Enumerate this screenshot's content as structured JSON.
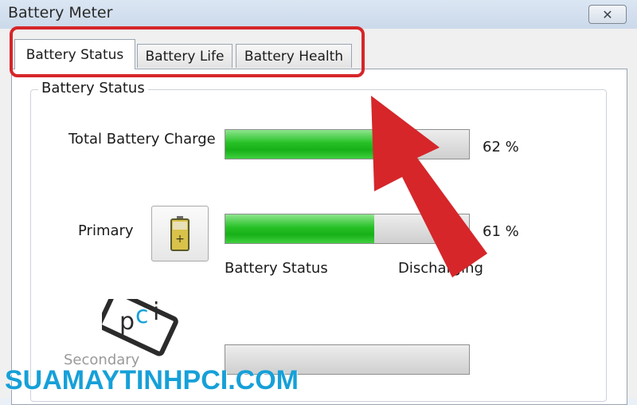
{
  "window": {
    "title": "Battery Meter",
    "close_symbol": "✕"
  },
  "tabs": [
    {
      "label": "Battery Status",
      "active": true
    },
    {
      "label": "Battery Life",
      "active": false
    },
    {
      "label": "Battery Health",
      "active": false
    }
  ],
  "group": {
    "label": "Battery Status",
    "total": {
      "label": "Total Battery Charge",
      "percent_value": 62,
      "percent_text": "62 %"
    },
    "primary": {
      "label": "Primary",
      "percent_value": 61,
      "percent_text": "61 %",
      "status_label": "Battery Status",
      "status_value": "Discharging",
      "icon": "battery-icon"
    },
    "secondary": {
      "label": "Secondary",
      "percent_value": 0
    }
  },
  "annotation": {
    "highlight_color": "#d6262a",
    "arrow_color": "#d6262a"
  },
  "watermark": {
    "text": "SUAMAYTINHPCI.COM",
    "logo": "pci",
    "color": "#16a0d8"
  }
}
